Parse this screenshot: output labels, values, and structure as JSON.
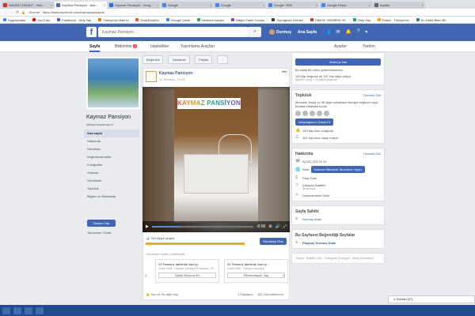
{
  "browser": {
    "tabs": [
      {
        "label": "DAVINCI DİZALP - Yeni...",
        "color": "#d93025",
        "active": false
      },
      {
        "label": "Kaymaz Pansiyon - Ana...",
        "color": "#4267b2",
        "active": true
      },
      {
        "label": "Kaymaz Pansiyon - Goog...",
        "color": "#1a73e8",
        "active": false
      },
      {
        "label": "Google",
        "color": "#4285f4",
        "active": false
      },
      {
        "label": "Google",
        "color": "#4285f4",
        "active": false
      },
      {
        "label": "Google YENİ",
        "color": "#4285f4",
        "active": false
      },
      {
        "label": "Google Ekspl...",
        "color": "#4285f4",
        "active": false
      },
      {
        "label": "Ayarlar",
        "color": "#5f6368",
        "active": false
      }
    ],
    "address": "https://www.facebook.com/kaymazpansiyon/",
    "address_prefix": "Güvenli",
    "bookmarks": [
      {
        "label": "Uygulamalar",
        "color": "#4285f4"
      },
      {
        "label": "YouTube",
        "color": "#ff0000"
      },
      {
        "label": "Facebook - Giriş Yap",
        "color": "#4267b2"
      },
      {
        "label": "Türkiye'nin lider bi",
        "color": "#e67e22"
      },
      {
        "label": "DuckDuckGo",
        "color": "#de5833"
      },
      {
        "label": "Google Çeviri",
        "color": "#4285f4"
      },
      {
        "label": "Merhem kanser",
        "color": "#27ae60"
      },
      {
        "label": "Bilişim Tarihi Cumhu",
        "color": "#8e44ad"
      },
      {
        "label": "Oyungezer Ürünler",
        "color": "#2c3e50"
      },
      {
        "label": "DİMOK YEDİREM YE",
        "color": "#c0392b"
      },
      {
        "label": "Giriş Yap",
        "color": "#16a085"
      },
      {
        "label": "Futbol - Türkiye'nin",
        "color": "#f39c12"
      },
      {
        "label": "En Fazla Bilen Bir",
        "color": "#2980b9"
      }
    ]
  },
  "facebook": {
    "logo": "f",
    "search_placeholder": "Kaymaz Pansiyon",
    "user_name": "Durmuş",
    "home_label": "Ana Sayfa"
  },
  "page_nav": {
    "items": [
      "Sayfa",
      "Bildirimler",
      "İstatistikler",
      "Yayımlama Araçları"
    ],
    "notif_count": "4",
    "right_items": [
      "Ayarlar",
      "Yardım"
    ]
  },
  "left": {
    "page_name": "Kaymaz Pansiyon",
    "handle": "@kaymazpansiyon",
    "nav": [
      "Ana sayfa",
      "Hakkında",
      "Hizmetler",
      "Değerlendirmeler",
      "Fotoğraflar",
      "Videolar",
      "Gönderiler",
      "Topluluk",
      "Bilgiler ve Reklamlar"
    ],
    "button_label": "Tanıtım Yap",
    "manage_link": "Tanıtımları Yönet"
  },
  "post": {
    "actions": [
      "Beğenildi",
      "Takiptesin",
      "Paylaş",
      "..."
    ],
    "author": "Kaymaz Pansiyon",
    "date": "11 Temmuz, 22:39",
    "video_overlay": "KAYMAZ PANSİYON",
    "video_time": "-0:00",
    "video_progress": 0.28,
    "reach": "763 kişiye erişildi",
    "reach_progress": 0.92,
    "boost_label": "Gönderiyi Öne Çıkar",
    "recent_label": "Yakındaki tatiller | tatilsepeti",
    "cards": [
      {
        "title": "23 Temmuz tarihinde özel çi...",
        "sub": "Hotel Kite, Türkiye Antalya Province, 10 -",
        "btn": "Şimdi Rezerve Et"
      },
      {
        "title": "20 Temmuz tarihinde özel çi...",
        "sub": "Hotel Kite, Türkiye Antalya",
        "btn": "Rezervasyon Yap"
      }
    ],
    "likes": "Sen ve 43 diğer kişi",
    "shares": "1 Paylaşım",
    "views": "352 Görüntülenme"
  },
  "right": {
    "video_button": "Video'yu İzle",
    "stats": "Bu hafta 85 video görüntülenmesi",
    "likes_text": "163 kişi beğendi ve 167 kişi takip ediyor",
    "likes_sub": "Ağırlıklı, yerel + 10 kişiler beğendi",
    "community_title": "Topluluk",
    "community_link": "Tümünü Gör",
    "community_text": "Mercanlı Anlaş ve 46 diğer arkadaşın buraya beğendi veya burada etkileşim kurdu",
    "invite_button": "Arkadaşlarını Davet Et",
    "community_likes": "163 kişi bunu beğendi",
    "community_follows": "167 kişi bunu takip ediyor",
    "about_title": "Hakkında",
    "about_link": "Tümünü Gör",
    "phone": "0(242) 224 03 26",
    "web_label": "Web",
    "web_button": "İnternet Sitenizin Tanıtımını Yapın",
    "price": "Fiyat Dahi",
    "hours": "Çalışma Saatleri",
    "hours_sub": "Şimdi Açık",
    "suggest": "Düzenlemeler Öner",
    "owner_title": "Sayfa Sahibi",
    "owner": "Durmuş Adalı",
    "liked_pages_title": "Bu Sayfanın Beğendiği Sayfalar",
    "liked_page": "Playboy Durmuş Adalı",
    "footer": "Türkçe · English (US) · Português (Portugal) · Kurdî (Kurmancî)",
    "chat": "Sohbet (67)"
  }
}
